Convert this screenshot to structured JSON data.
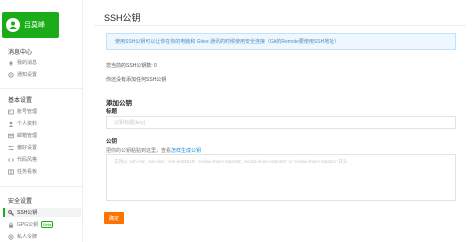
{
  "user": {
    "name": "吕莫峰"
  },
  "sidebar": {
    "sections": [
      {
        "title": "消息中心",
        "items": [
          {
            "label": "我的消息",
            "icon": "bell-icon"
          },
          {
            "label": "通知设置",
            "icon": "gear-icon"
          }
        ]
      },
      {
        "title": "基本设置",
        "items": [
          {
            "label": "账号管理",
            "icon": "user-card-icon"
          },
          {
            "label": "个人资料",
            "icon": "person-icon"
          },
          {
            "label": "邮箱管理",
            "icon": "mail-icon"
          },
          {
            "label": "偏好设置",
            "icon": "sliders-icon"
          },
          {
            "label": "代码风格",
            "icon": "code-icon"
          },
          {
            "label": "任务看板",
            "icon": "board-icon"
          }
        ]
      },
      {
        "title": "安全设置",
        "items": [
          {
            "label": "SSH公钥",
            "icon": "key-icon",
            "active": true
          },
          {
            "label": "GPG公钥",
            "icon": "lock-icon",
            "badge": "Beta"
          },
          {
            "label": "私人令牌",
            "icon": "token-icon"
          }
        ]
      }
    ]
  },
  "main": {
    "title": "SSH公钥",
    "notice": "使用SSH公钥可以让你在你的电脑和 Gitee 通讯的时候使用安全连接（Git的Remote要使用SSH地址）",
    "key_count": "您当前的SSH公钥数: 0",
    "empty_text": "你还没有添加任何SSH公钥",
    "add_heading": "添加公钥",
    "title_label": "标题",
    "title_placeholder": "公钥标题(key)",
    "key_label": "公钥",
    "key_hint_prefix": "把你的公钥粘贴到这里，查看",
    "key_hint_link": "怎样生成公钥",
    "key_placeholder": "支持以 'ssh-rsa', 'ssh-dss', 'ssh-ed25519', 'ecdsa-sha2-nistp256', 'ecdsa-sha2-nistp384' or 'ecdsa-sha2-nistp521' 开头",
    "submit_label": "确定"
  },
  "colors": {
    "brand_green": "#1aad19",
    "accent_orange": "#fe7300",
    "link_blue": "#1a8fe3",
    "notice_bg": "#eef7fd"
  }
}
